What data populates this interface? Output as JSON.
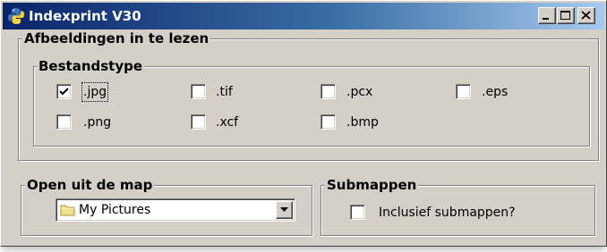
{
  "window": {
    "title": "Indexprint V30",
    "app_icon": "python-icon",
    "titlebar_colors": [
      "#0a246a",
      "#a6caf0"
    ],
    "controls": {
      "minimize_icon": "minimize-icon",
      "maximize_icon": "maximize-icon",
      "close_icon": "close-icon"
    }
  },
  "groups": {
    "afbeeldingen": {
      "legend": "Afbeeldingen in te lezen"
    },
    "bestandstype": {
      "legend": "Bestandstype",
      "options": [
        {
          "label": ".jpg",
          "checked": true
        },
        {
          "label": ".tif",
          "checked": false
        },
        {
          "label": ".pcx",
          "checked": false
        },
        {
          "label": ".eps",
          "checked": false
        },
        {
          "label": ".png",
          "checked": false
        },
        {
          "label": ".xcf",
          "checked": false
        },
        {
          "label": ".bmp",
          "checked": false
        }
      ]
    },
    "open_folder": {
      "legend": "Open uit de map",
      "selected": "My Pictures",
      "icon": "folder-icon"
    },
    "submappen": {
      "legend": "Submappen",
      "checkbox_label": "Inclusief submappen?",
      "checked": false
    }
  }
}
